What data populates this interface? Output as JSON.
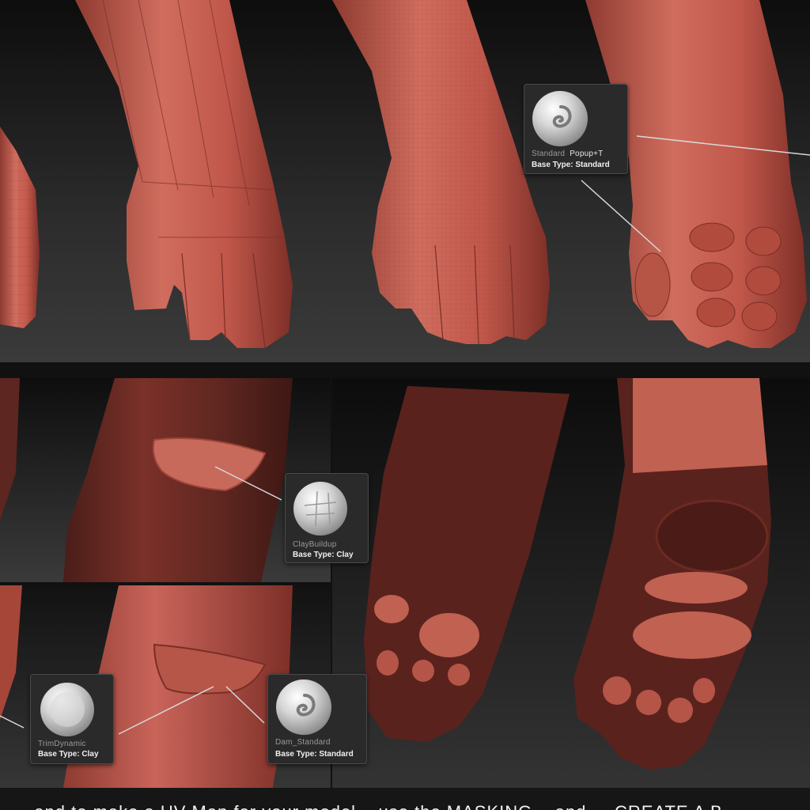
{
  "popups": {
    "standard": {
      "name": "Standard",
      "hotkey": "Popup+T",
      "type": "Base Type: Standard",
      "icon": "swirl-brush-icon"
    },
    "claybuildup": {
      "name": "ClayBuildup",
      "type": "Base Type: Clay",
      "icon": "clay-brush-icon"
    },
    "trimdynamic": {
      "name": "TrimDynamic",
      "type": "Base Type: Clay",
      "icon": "flat-brush-icon"
    },
    "dam_standard": {
      "name": "Dam_Standard",
      "type": "Base Type: Standard",
      "icon": "swirl-brush-icon"
    }
  },
  "caption": "...and to make a UV Map for your model... use the MASKING... and ... CREATE A B...",
  "colors": {
    "skin": "#c0574a",
    "skin_dark": "#5e2620",
    "background": "#1c1c1c"
  }
}
